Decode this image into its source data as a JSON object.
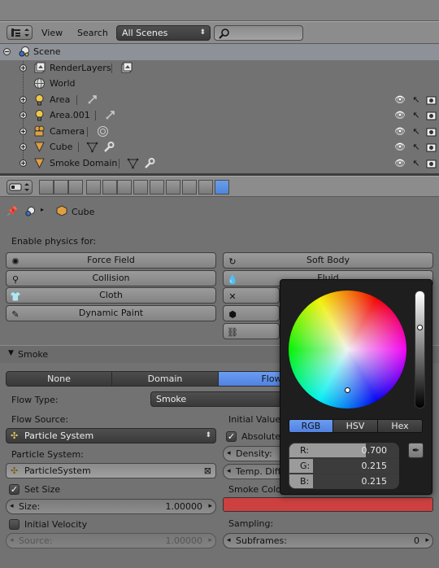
{
  "outliner": {
    "menu": [
      "View",
      "Search"
    ],
    "display_mode": "All Scenes",
    "search_placeholder": "",
    "tree": [
      {
        "label": "Scene",
        "icon": "scene-icon",
        "level": 0
      },
      {
        "label": "RenderLayers",
        "icon": "render-layers-icon",
        "level": 1
      },
      {
        "label": "World",
        "icon": "world-icon",
        "level": 1
      },
      {
        "label": "Area",
        "icon": "lamp-icon",
        "level": 1
      },
      {
        "label": "Area.001",
        "icon": "lamp-icon",
        "level": 1
      },
      {
        "label": "Camera",
        "icon": "camera-icon",
        "level": 1
      },
      {
        "label": "Cube",
        "icon": "mesh-icon",
        "level": 1
      },
      {
        "label": "Smoke Domain",
        "icon": "mesh-icon",
        "level": 1
      }
    ]
  },
  "properties": {
    "breadcrumb": "Cube",
    "enable_physics_label": "Enable physics for:",
    "physics_left": [
      "Force Field",
      "Collision",
      "Cloth",
      "Dynamic Paint"
    ],
    "physics_right": [
      "Soft Body",
      "Fluid"
    ],
    "smoke_panel": {
      "title": "Smoke",
      "types": [
        "None",
        "Domain",
        "Flow"
      ],
      "active_type": "Flow",
      "flow_type_label": "Flow Type:",
      "flow_type_value": "Smoke",
      "flow_source_label": "Flow Source:",
      "flow_source_value": "Particle System",
      "particle_system_label": "Particle System:",
      "particle_system_value": "ParticleSystem",
      "set_size_label": "Set Size",
      "size_label": "Size:",
      "size_value": "1.00000",
      "initial_velocity_label": "Initial Velocity",
      "source_label": "Source:",
      "source_value": "1.00000",
      "initial_values_label": "Initial Values",
      "absolute_label": "Absolute",
      "density_label": "Density:",
      "temp_diff_label": "Temp. Diff.:",
      "smoke_color_label": "Smoke Color",
      "smoke_color": "#cc4040",
      "sampling_label": "Sampling:",
      "subframes_label": "Subframes:",
      "subframes_value": "0"
    }
  },
  "color_picker": {
    "tabs": [
      "RGB",
      "HSV",
      "Hex"
    ],
    "active_tab": "RGB",
    "channels": [
      {
        "label": "R:",
        "value": "0.700",
        "fraction": 0.7
      },
      {
        "label": "G:",
        "value": "0.215",
        "fraction": 0.215
      },
      {
        "label": "B:",
        "value": "0.215",
        "fraction": 0.215
      }
    ],
    "value_level": 0.7
  },
  "colors": {
    "accent": "#5a8ce6",
    "panel": "#727272",
    "header": "#8c8c8c",
    "popup": "#1e1e1e"
  }
}
